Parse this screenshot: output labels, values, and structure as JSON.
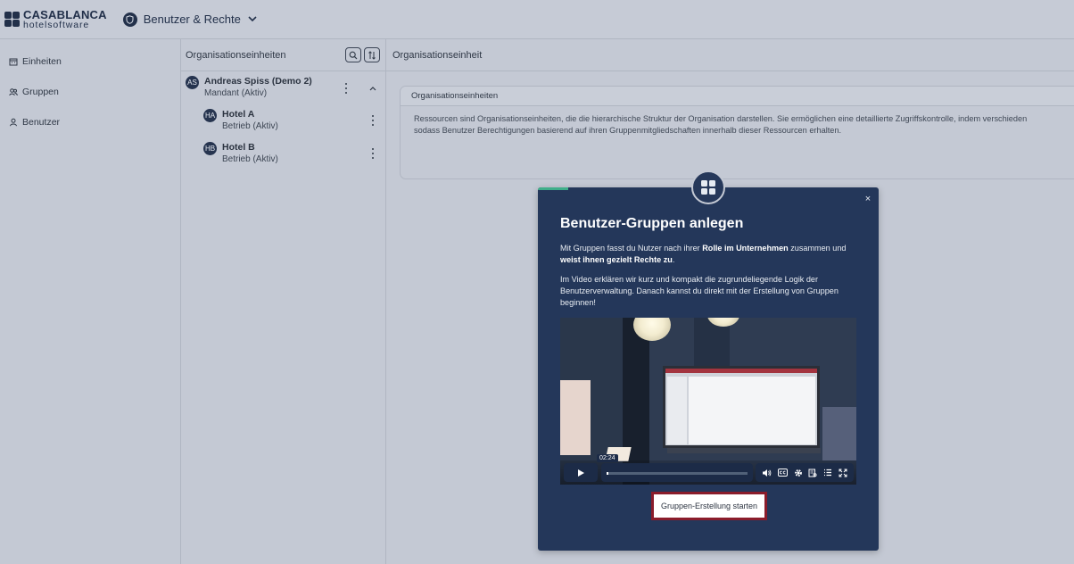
{
  "header": {
    "logo_top": "CASABLANCA",
    "logo_bottom": "hotelsoftware",
    "app_title": "Benutzer & Rechte"
  },
  "sidebar": {
    "items": [
      {
        "label": "Einheiten",
        "icon": "building-icon"
      },
      {
        "label": "Gruppen",
        "icon": "group-icon"
      },
      {
        "label": "Benutzer",
        "icon": "user-icon"
      }
    ]
  },
  "tree": {
    "title": "Organisationseinheiten",
    "nodes": [
      {
        "initials": "AS",
        "name": "Andreas Spiss (Demo 2)",
        "sub": "Mandant (Aktiv)"
      },
      {
        "initials": "HA",
        "name": "Hotel A",
        "sub": "Betrieb (Aktiv)"
      },
      {
        "initials": "HB",
        "name": "Hotel B",
        "sub": "Betrieb (Aktiv)"
      }
    ]
  },
  "main": {
    "title": "Organisationseinheit",
    "card": {
      "title": "Organisationseinheiten",
      "line1": "Ressourcen sind Organisationseinheiten, die die hierarchische Struktur der Organisation darstellen. Sie ermöglichen eine detaillierte Zugriffskontrolle, indem verschieden",
      "line2": "sodass Benutzer Berechtigungen basierend auf ihren Gruppenmitgliedschaften innerhalb dieser Ressourcen erhalten."
    }
  },
  "modal": {
    "title": "Benutzer-Gruppen anlegen",
    "p1_a": "Mit Gruppen fasst du Nutzer nach ihrer ",
    "p1_b": "Rolle im Unternehmen",
    "p1_c": " zusammen und ",
    "p1_d": "weist ihnen gezielt Rechte zu",
    "p1_e": ".",
    "p2": "Im Video erklären wir kurz und kompakt die zugrundeliegende Logik der Benutzerverwaltung. Danach kannst du direkt mit der Erstellung von Gruppen beginnen!",
    "video_time": "02:24",
    "cta": "Gruppen-Erstellung starten",
    "close": "×"
  },
  "colors": {
    "modal_bg": "#24375a",
    "accent_green": "#3fae8a",
    "cta_border": "#8a1c2b"
  }
}
